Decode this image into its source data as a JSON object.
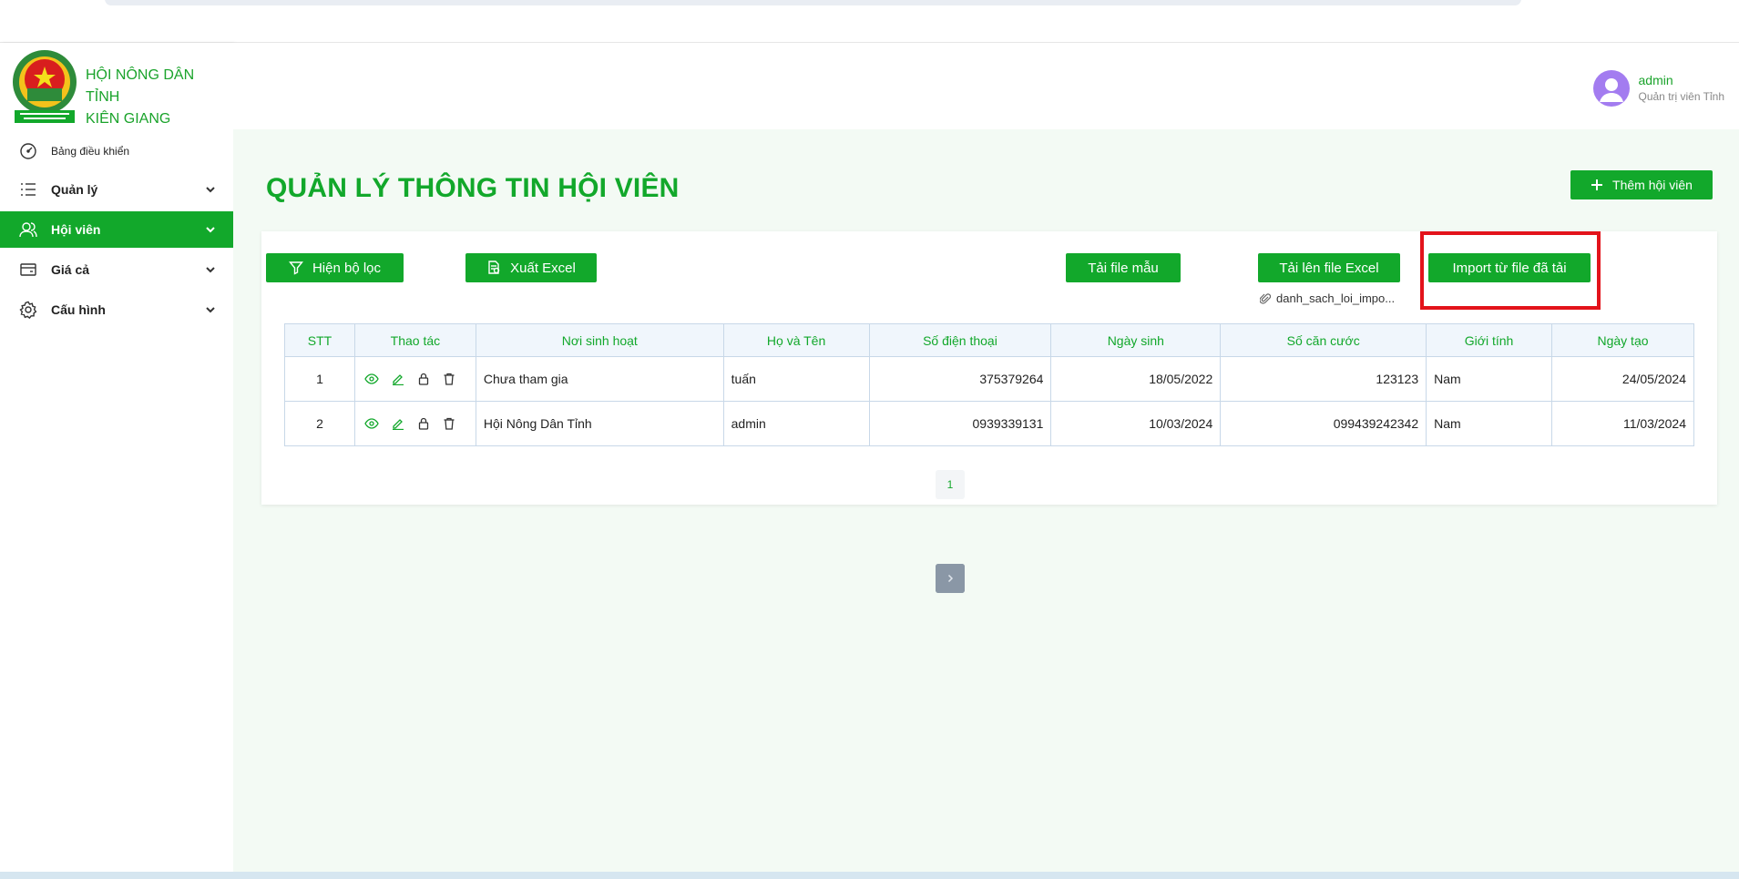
{
  "brand": {
    "line1": "HỘI NÔNG DÂN TỈNH",
    "line2": "KIÊN GIANG"
  },
  "sidebar": {
    "items": [
      {
        "label": "Bảng điều khiển",
        "icon": "dashboard-icon"
      },
      {
        "label": "Quản lý",
        "icon": "list-icon"
      },
      {
        "label": "Hội viên",
        "icon": "users-icon",
        "active": true
      },
      {
        "label": "Giá cả",
        "icon": "card-icon"
      },
      {
        "label": "Cấu hình",
        "icon": "gear-icon"
      }
    ]
  },
  "user": {
    "name": "admin",
    "role": "Quản trị viên Tỉnh"
  },
  "page": {
    "title": "QUẢN LÝ THÔNG TIN HỘI VIÊN",
    "add_button": "Thêm hội viên"
  },
  "toolbar": {
    "filter": "Hiện bộ lọc",
    "export": "Xuất Excel",
    "template": "Tải file mẫu",
    "upload": "Tải lên file Excel",
    "import": "Import từ file đã tải",
    "file_name": "danh_sach_loi_impo..."
  },
  "table": {
    "headers": [
      "STT",
      "Thao tác",
      "Nơi sinh hoạt",
      "Họ và Tên",
      "Số điện thoại",
      "Ngày sinh",
      "Số căn cước",
      "Giới tính",
      "Ngày tạo"
    ],
    "rows": [
      {
        "stt": "1",
        "place": "Chưa tham gia",
        "name": "tuấn",
        "phone": "375379264",
        "dob": "18/05/2022",
        "id": "123123",
        "gender": "Nam",
        "created": "24/05/2024"
      },
      {
        "stt": "2",
        "place": "Hội Nông Dân Tỉnh",
        "name": "admin",
        "phone": "0939339131",
        "dob": "10/03/2024",
        "id": "099439242342",
        "gender": "Nam",
        "created": "11/03/2024"
      }
    ]
  },
  "pagination": {
    "current": "1"
  },
  "colors": {
    "primary": "#12a82b",
    "highlight": "#e3131b",
    "avatar": "#a37cf0"
  }
}
